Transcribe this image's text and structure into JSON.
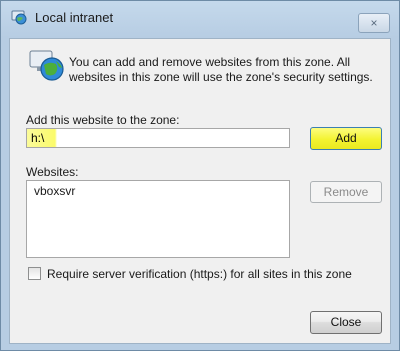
{
  "window": {
    "title": "Local intranet",
    "close_glyph": "×"
  },
  "dialog": {
    "info_text": "You can add and remove websites from this zone. All websites in this zone will use the zone's security settings.",
    "add_label": "Add this website to the zone:",
    "website_input_value": "h:\\",
    "add_button": "Add",
    "websites_label": "Websites:",
    "websites": [
      "vboxsvr"
    ],
    "remove_button": "Remove",
    "checkbox_label": "Require server verification (https:) for all sites in this zone",
    "checkbox_checked": false,
    "close_button": "Close"
  },
  "icons": {
    "title_icon": "intranet-globe-icon",
    "info_icon": "globe-network-icon"
  },
  "colors": {
    "highlight": "#f3f331",
    "frame": "#b7cde3"
  }
}
